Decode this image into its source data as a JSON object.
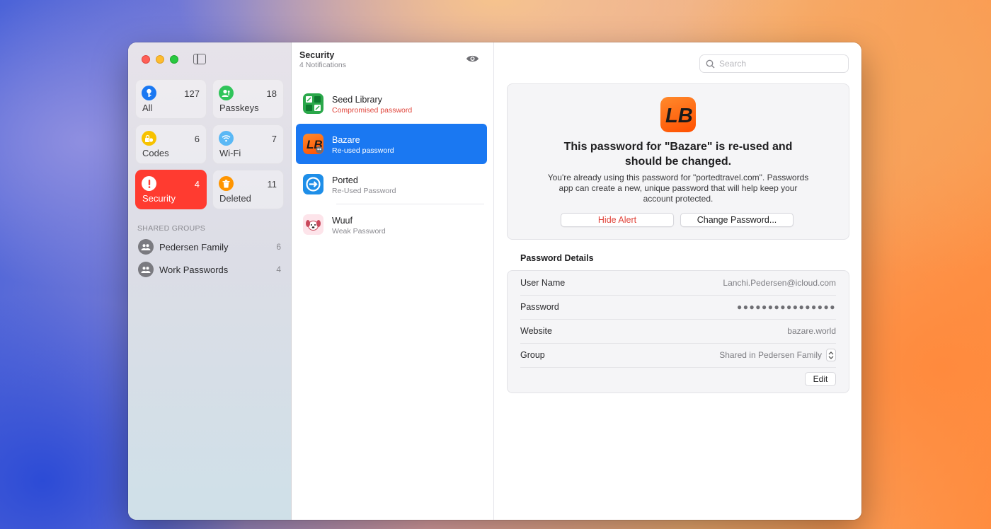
{
  "sidebar": {
    "tiles": [
      {
        "label": "All",
        "count": "127",
        "icon": "key-icon",
        "color": "#1a78f2"
      },
      {
        "label": "Passkeys",
        "count": "18",
        "icon": "person-badge-icon",
        "color": "#30c45a"
      },
      {
        "label": "Codes",
        "count": "6",
        "icon": "lock-clock-icon",
        "color": "#f7c200"
      },
      {
        "label": "Wi-Fi",
        "count": "7",
        "icon": "wifi-icon",
        "color": "#5ab8f5"
      },
      {
        "label": "Security",
        "count": "4",
        "icon": "exclamation-icon",
        "color": "#ff3b30",
        "active": true
      },
      {
        "label": "Deleted",
        "count": "11",
        "icon": "trash-icon",
        "color": "#ff9500"
      }
    ],
    "shared_groups_header": "SHARED GROUPS",
    "groups": [
      {
        "label": "Pedersen Family",
        "count": "6"
      },
      {
        "label": "Work Passwords",
        "count": "4"
      }
    ]
  },
  "list": {
    "title": "Security",
    "subtitle": "4 Notifications",
    "items": [
      {
        "title": "Seed Library",
        "subtitle": "Compromised password",
        "icon": "seed-library-app-icon"
      },
      {
        "title": "Bazare",
        "subtitle": "Re-used password",
        "icon": "bazare-app-icon",
        "selected": true
      },
      {
        "title": "Ported",
        "subtitle": "Re-Used Password",
        "icon": "ported-app-icon"
      },
      {
        "title": "Wuuf",
        "subtitle": "Weak Password",
        "icon": "wuuf-app-icon"
      }
    ]
  },
  "detail": {
    "search_placeholder": "Search",
    "alert": {
      "title": "This password for \"Bazare\" is re-used and should be changed.",
      "body": "You're already using this password for \"portedtravel.com\". Passwords app can create a new, unique password that will help keep your account protected.",
      "hide_label": "Hide Alert",
      "change_label": "Change Password..."
    },
    "details_title": "Password Details",
    "fields": [
      {
        "label": "User Name",
        "value": "Lanchi.Pedersen@icloud.com"
      },
      {
        "label": "Password",
        "value": "●●●●●●●●●●●●●●●●"
      },
      {
        "label": "Website",
        "value": "bazare.world"
      },
      {
        "label": "Group",
        "value": "Shared in Pedersen Family"
      }
    ],
    "edit_label": "Edit"
  },
  "colors": {
    "accent": "#1a78f2",
    "danger": "#e0443a",
    "bazare_orange": "#ff6a13"
  }
}
